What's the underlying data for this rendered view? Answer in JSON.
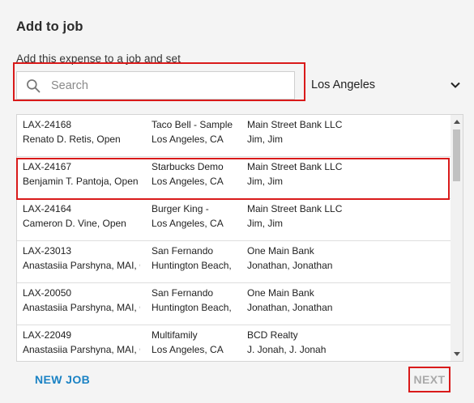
{
  "dialog": {
    "title": "Add to job",
    "subtitle": "Add this expense to a job and set"
  },
  "search": {
    "placeholder": "Search",
    "value": ""
  },
  "location": {
    "selected": "Los Angeles"
  },
  "jobs": [
    {
      "id": "LAX-24168",
      "owner": "Renato D. Retis, Open",
      "name": "Taco Bell - Sample",
      "city": "Los Angeles, CA",
      "client": "Main Street Bank LLC",
      "contact": "Jim, Jim"
    },
    {
      "id": "LAX-24167",
      "owner": "Benjamin T. Pantoja, Open",
      "name": "Starbucks Demo",
      "city": "Los Angeles, CA",
      "client": "Main Street Bank LLC",
      "contact": "Jim, Jim"
    },
    {
      "id": "LAX-24164",
      "owner": "Cameron D. Vine, Open",
      "name": "Burger King -",
      "city": "Los Angeles, CA",
      "client": "Main Street Bank LLC",
      "contact": "Jim, Jim"
    },
    {
      "id": "LAX-23013",
      "owner": "Anastasiia Parshyna, MAI, C",
      "name": "San Fernando",
      "city": "Huntington Beach,",
      "client": "One Main Bank",
      "contact": "Jonathan, Jonathan"
    },
    {
      "id": "LAX-20050",
      "owner": "Anastasiia Parshyna, MAI, C",
      "name": "San Fernando",
      "city": "Huntington Beach,",
      "client": "One Main Bank",
      "contact": "Jonathan, Jonathan"
    },
    {
      "id": "LAX-22049",
      "owner": "Anastasiia Parshyna, MAI, C",
      "name": "Multifamily",
      "city": "Los Angeles, CA",
      "client": "BCD Realty",
      "contact": "J. Jonah, J. Jonah"
    }
  ],
  "actions": {
    "new_job": "NEW JOB",
    "next": "NEXT"
  },
  "icons": {
    "search": "search-icon",
    "dropdown": "chevron-down-icon"
  },
  "colors": {
    "accent": "#1a82c4",
    "highlight": "#d91a1a",
    "disabled": "#a9a9a9"
  }
}
